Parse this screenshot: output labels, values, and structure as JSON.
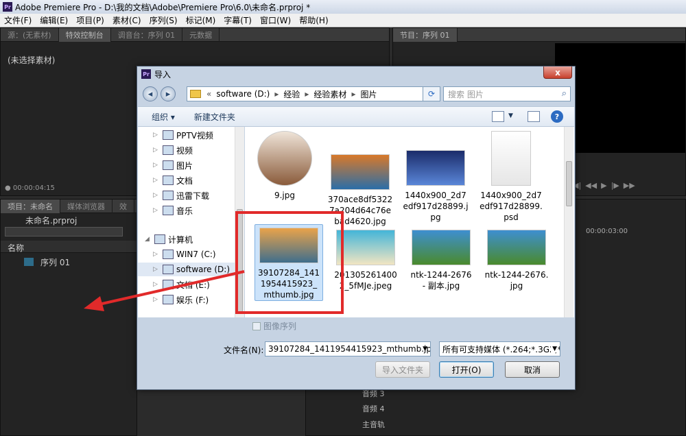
{
  "app": {
    "title": "Adobe Premiere Pro - D:\\我的文档\\Adobe\\Premiere Pro\\6.0\\未命名.prproj *",
    "logo": "Pr",
    "menu": [
      "文件(F)",
      "编辑(E)",
      "项目(P)",
      "素材(C)",
      "序列(S)",
      "标记(M)",
      "字幕(T)",
      "窗口(W)",
      "帮助(H)"
    ]
  },
  "source_panel": {
    "tabs": [
      "源：(无素材)",
      "特效控制台",
      "调音台：序列 01",
      "元数据"
    ],
    "empty_label": "(未选择素材)",
    "timecode": "00:00:04:15"
  },
  "program_panel": {
    "tab": "节目：序列 01"
  },
  "project_panel": {
    "tabs": [
      "项目：未命名",
      "媒体浏览器",
      "效"
    ],
    "project_file": "未命名.prproj",
    "column_name": "名称",
    "items": [
      "序列 01"
    ]
  },
  "timeline": {
    "timecode": "00:00:03:00",
    "tracks": [
      "音频 3",
      "音频 4",
      "主音轨"
    ]
  },
  "dialog": {
    "title": "导入",
    "close": "x",
    "breadcrumb": [
      "software (D:)",
      "经验",
      "经验素材",
      "图片"
    ],
    "breadcrumb_prefix": "«",
    "search_placeholder": "搜索 图片",
    "organize": "组织 ▾",
    "new_folder": "新建文件夹",
    "nav_items": [
      {
        "label": "PPTV视频",
        "icon": "video-folder-icon"
      },
      {
        "label": "视频",
        "icon": "video-library-icon"
      },
      {
        "label": "图片",
        "icon": "picture-library-icon"
      },
      {
        "label": "文档",
        "icon": "document-library-icon"
      },
      {
        "label": "迅雷下载",
        "icon": "download-folder-icon"
      },
      {
        "label": "音乐",
        "icon": "music-library-icon"
      }
    ],
    "computer_label": "计算机",
    "drives": [
      {
        "label": "WIN7 (C:)",
        "selected": false
      },
      {
        "label": "software (D:)",
        "selected": true
      },
      {
        "label": "文档 (E:)",
        "selected": false
      },
      {
        "label": "娱乐 (F:)",
        "selected": false
      }
    ],
    "files": [
      {
        "name": "9.jpg",
        "thumb": [
          "#efe4d8",
          "#8a5b3b"
        ]
      },
      {
        "name": "370ace8df53227a204d64c76ebad4620.jpg",
        "thumb": [
          "#d8792a",
          "#2a6ea8"
        ]
      },
      {
        "name": "1440x900_2d7edf917d28899.jpg",
        "thumb": [
          "#1b2c6a",
          "#5a86d8"
        ]
      },
      {
        "name": "1440x900_2d7edf917d28899.psd",
        "thumb": [
          "#ffffff",
          "#e6e6e6"
        ]
      },
      {
        "name": "39107284_1411954415923_mthumb.jpg",
        "thumb": [
          "#e9a34a",
          "#3f6e8c"
        ],
        "selected": true
      },
      {
        "name": "2013052614002_5fMJe.jpeg",
        "thumb": [
          "#44b5d8",
          "#f2e5c2"
        ]
      },
      {
        "name": "ntk-1244-2676 - 副本.jpg",
        "thumb": [
          "#3e8fd0",
          "#4a8a2c"
        ]
      },
      {
        "name": "ntk-1244-2676.jpg",
        "thumb": [
          "#3e8fd0",
          "#4a8a2c"
        ]
      }
    ],
    "image_sequence_label": "图像序列",
    "filename_label": "文件名(N):",
    "filename_value": "39107284_1411954415923_mthumb.jpg",
    "filter_value": "所有可支持媒体 (*.264;*.3G2;*",
    "import_folder_button": "导入文件夹",
    "open_button": "打开(O)",
    "cancel_button": "取消"
  },
  "annotation": {
    "color": "#e12a2a"
  }
}
